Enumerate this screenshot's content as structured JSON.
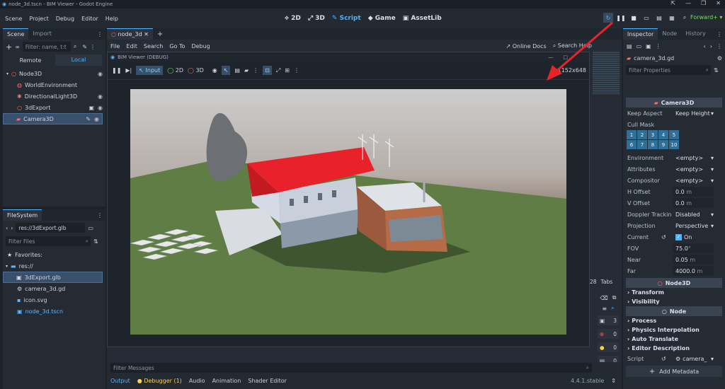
{
  "window": {
    "title": "node_3d.tscn - BIM Viewer - Godot Engine",
    "controls": [
      "⇱",
      "—",
      "❐",
      "✕"
    ]
  },
  "menu": [
    "Scene",
    "Project",
    "Debug",
    "Editor",
    "Help"
  ],
  "workspaces": [
    "2D",
    "3D",
    "Script",
    "Game",
    "AssetLib"
  ],
  "renderer": "Forward+",
  "scene_dock": {
    "tabs": [
      "Scene",
      "Import"
    ],
    "filter_placeholder": "Filter: name, t:t",
    "remote_label": "Remote",
    "local_label": "Local",
    "nodes": [
      {
        "name": "Node3D"
      },
      {
        "name": "WorldEnvironment"
      },
      {
        "name": "DirectionalLight3D"
      },
      {
        "name": "3dExport"
      },
      {
        "name": "Camera3D"
      }
    ]
  },
  "filesystem": {
    "tab": "FileSystem",
    "path": "res://3dExport.glb",
    "filter_placeholder": "Filter Files",
    "favorites_label": "Favorites:",
    "items": [
      {
        "name": "res://"
      },
      {
        "name": "3dExport.glb"
      },
      {
        "name": "camera_3d.gd"
      },
      {
        "name": "icon.svg"
      },
      {
        "name": "node_3d.tscn"
      }
    ]
  },
  "editor": {
    "tab": "node_3d",
    "script_menu": [
      "File",
      "Edit",
      "Search",
      "Go To",
      "Debug"
    ],
    "online_docs": "Online Docs",
    "search_help": "Search Help",
    "tabs_label": "Tabs",
    "line_count": "28"
  },
  "game_window": {
    "title": "BIM Viewer (DEBUG)",
    "controls": [
      "—",
      "□"
    ],
    "toolbar": {
      "input": "Input",
      "mode_2d": "2D",
      "mode_3d": "3D"
    },
    "resolution": "1152x648"
  },
  "inspector": {
    "tabs": [
      "Inspector",
      "Node",
      "History"
    ],
    "object": "camera_3d.gd",
    "filter_placeholder": "Filter Properties",
    "class_header": "Camera3D",
    "keep_aspect": {
      "label": "Keep Aspect",
      "value": "Keep Height"
    },
    "cull_mask": {
      "label": "Cull Mask",
      "layers": [
        "1",
        "2",
        "3",
        "4",
        "5",
        "6",
        "7",
        "8",
        "9",
        "10"
      ]
    },
    "props": [
      {
        "label": "Environment",
        "value": "<empty>"
      },
      {
        "label": "Attributes",
        "value": "<empty>"
      },
      {
        "label": "Compositor",
        "value": "<empty>"
      },
      {
        "label": "H Offset",
        "value": "0.0",
        "unit": "m"
      },
      {
        "label": "V Offset",
        "value": "0.0",
        "unit": "m"
      },
      {
        "label": "Doppler Trackin",
        "value": "Disabled"
      },
      {
        "label": "Projection",
        "value": "Perspective"
      },
      {
        "label": "Current",
        "value": "On"
      },
      {
        "label": "FOV",
        "value": "75.0",
        "unit": "°"
      },
      {
        "label": "Near",
        "value": "0.05",
        "unit": "m"
      },
      {
        "label": "Far",
        "value": "4000.0",
        "unit": "m"
      }
    ],
    "node3d_header": "Node3D",
    "node3d_sections": [
      "Transform",
      "Visibility"
    ],
    "node_header": "Node",
    "node_sections": [
      "Process",
      "Physics Interpolation",
      "Auto Translate",
      "Editor Description"
    ],
    "script": {
      "label": "Script",
      "value": "camera_"
    },
    "add_metadata": "Add Metadata"
  },
  "bottom": {
    "filter_messages": "Filter Messages",
    "tabs": [
      "Output",
      "Debugger (1)",
      "Audio",
      "Animation",
      "Shader Editor"
    ],
    "version": "4.4.1.stable",
    "counts": [
      "3",
      "0",
      "0",
      "0"
    ]
  },
  "colors": {
    "accent": "#4fb3ff",
    "renderer": "#7fdc5a",
    "roof": "#e8212a",
    "ground": "#5f7d44",
    "sky_top": "#c9c9c9",
    "sky_horizon": "#4a3526"
  }
}
